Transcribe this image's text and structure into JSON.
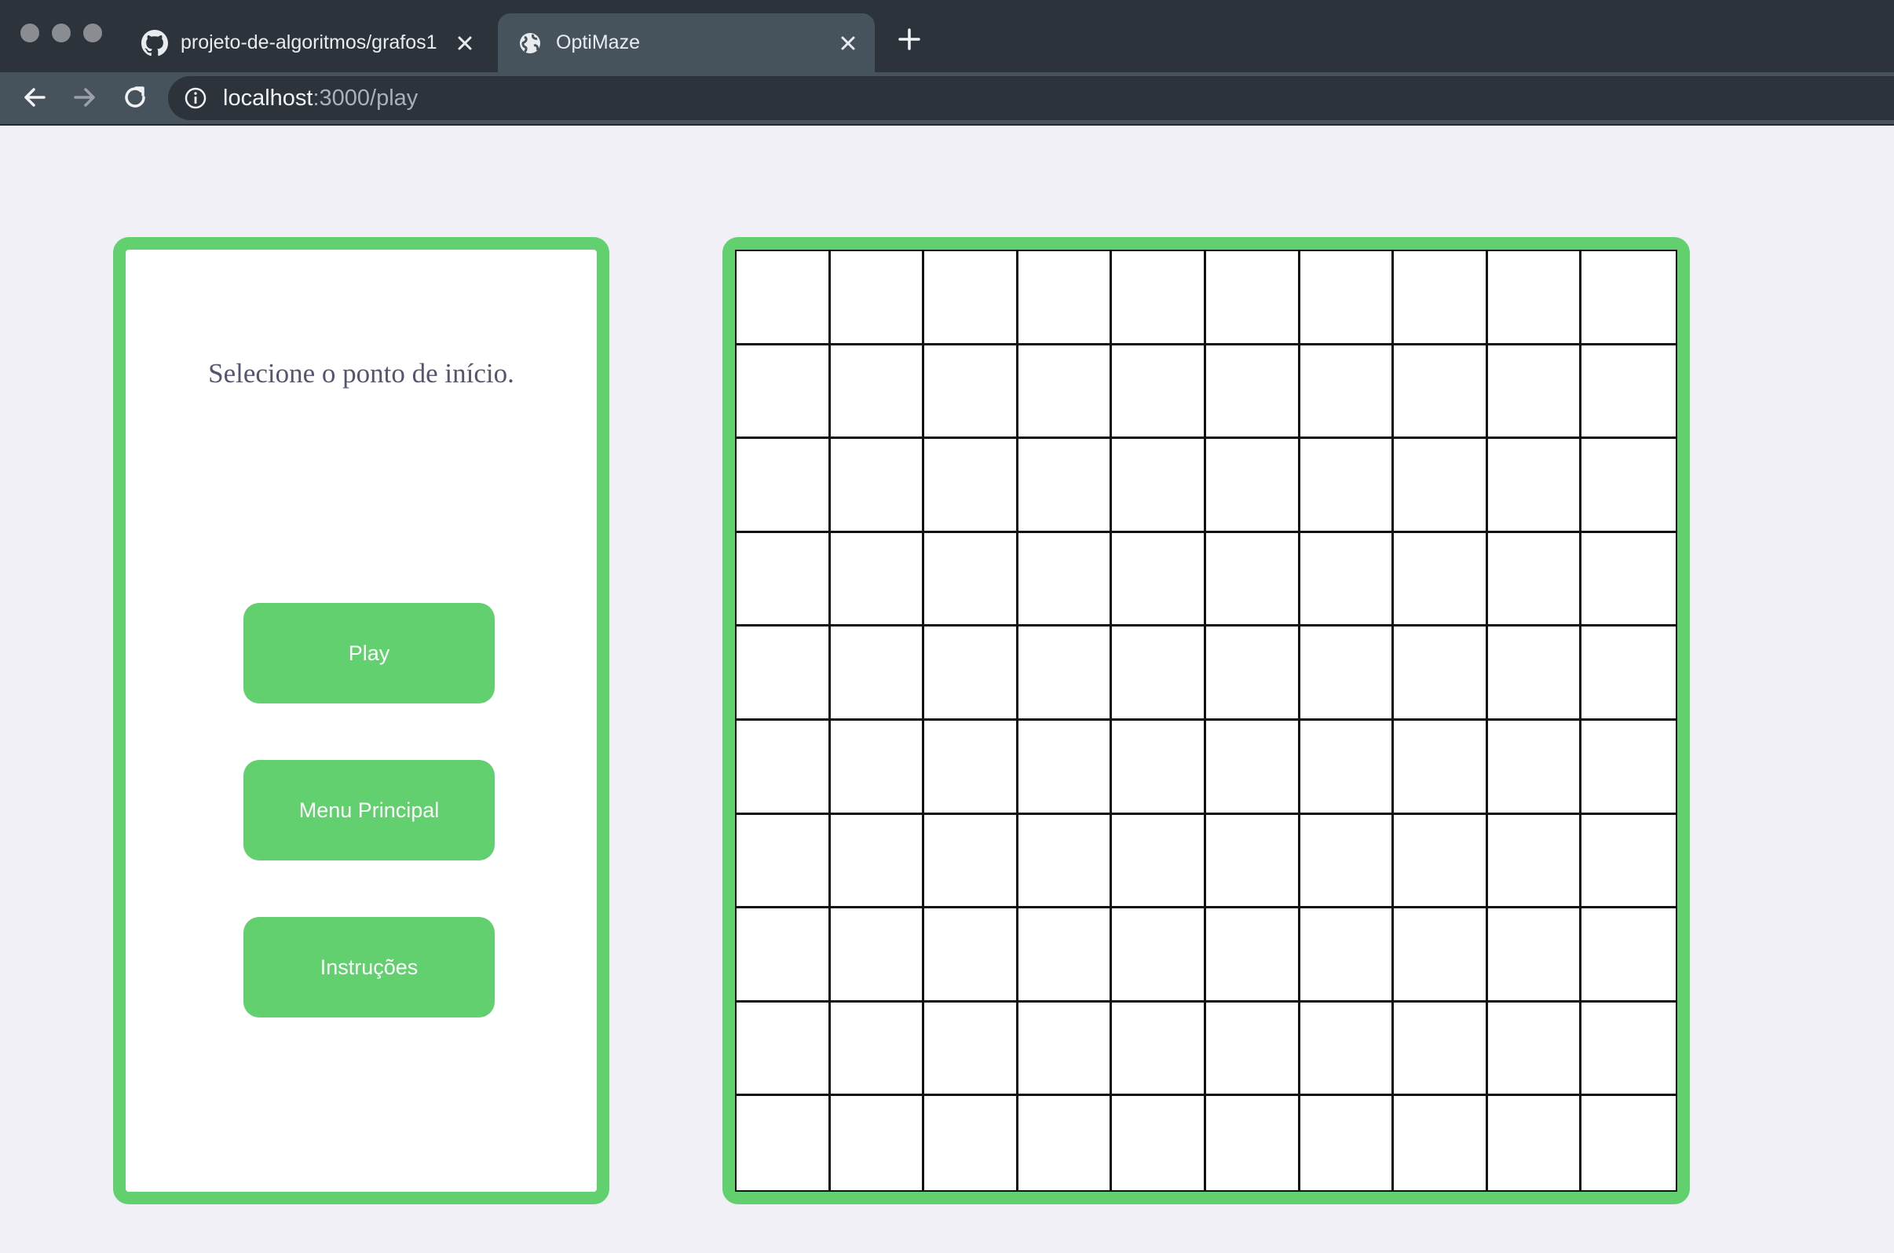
{
  "browser": {
    "tabs": [
      {
        "title": "projeto-de-algoritmos/grafos1",
        "icon": "github-icon",
        "active": false
      },
      {
        "title": "OptiMaze",
        "icon": "globe-icon",
        "active": true
      }
    ],
    "url_host": "localhost",
    "url_path": ":3000/play"
  },
  "sidebar": {
    "prompt": "Selecione o ponto de início.",
    "buttons": [
      {
        "label": "Play"
      },
      {
        "label": "Menu Principal"
      },
      {
        "label": "Instruções"
      }
    ]
  },
  "maze": {
    "rows": 10,
    "cols": 10
  },
  "colors": {
    "accent": "#62d06f",
    "page_background": "#f0f0f6",
    "prompt_text": "#54556e",
    "grid_line": "#111111"
  }
}
